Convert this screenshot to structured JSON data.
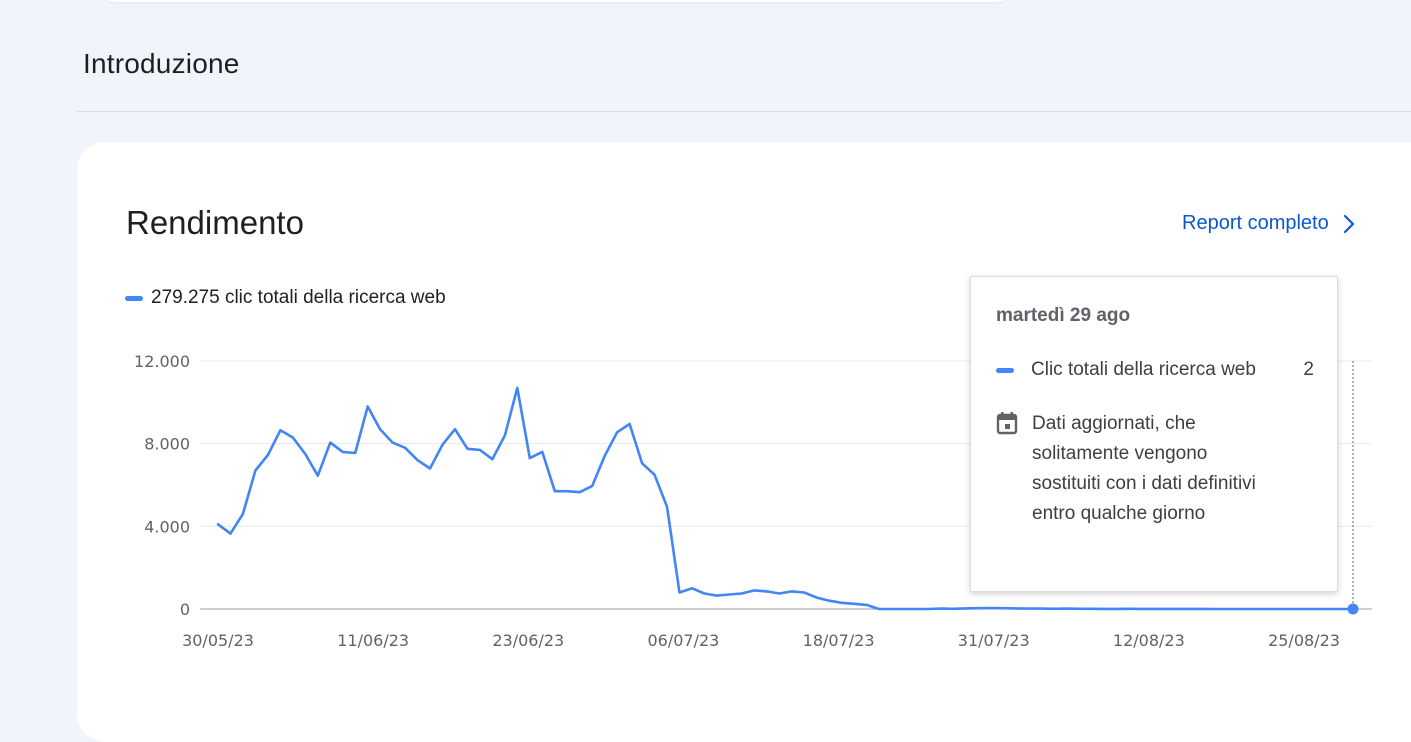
{
  "page": {
    "title": "Introduzione"
  },
  "card": {
    "title": "Rendimento",
    "report_link": "Report completo"
  },
  "legend": {
    "label": "279.275 clic totali della ricerca web",
    "color": "#4285f4"
  },
  "tooltip": {
    "date": "martedì 29 ago",
    "series_label": "Clic totali della ricerca web",
    "series_value": "2",
    "note": "Dati aggiornati, che solitamente vengono sostituiti con i dati definitivi entro qualche giorno",
    "note_icon": "calendar-icon"
  },
  "chart_data": {
    "type": "line",
    "y_tick_labels": [
      "12.000",
      "8.000",
      "4.000",
      "0"
    ],
    "x_tick_labels": [
      "30/05/23",
      "11/06/23",
      "23/06/23",
      "06/07/23",
      "18/07/23",
      "31/07/23",
      "12/08/23",
      "25/08/23"
    ],
    "ylim": [
      0,
      12000
    ],
    "grid": true,
    "legend_position": "top-left",
    "series": [
      {
        "name": "clic totali della ricerca web",
        "color": "#4285f4",
        "x": [
          "2023-05-30",
          "2023-05-31",
          "2023-06-01",
          "2023-06-02",
          "2023-06-03",
          "2023-06-04",
          "2023-06-05",
          "2023-06-06",
          "2023-06-07",
          "2023-06-08",
          "2023-06-09",
          "2023-06-10",
          "2023-06-11",
          "2023-06-12",
          "2023-06-13",
          "2023-06-14",
          "2023-06-15",
          "2023-06-16",
          "2023-06-17",
          "2023-06-18",
          "2023-06-19",
          "2023-06-20",
          "2023-06-21",
          "2023-06-22",
          "2023-06-23",
          "2023-06-24",
          "2023-06-25",
          "2023-06-26",
          "2023-06-27",
          "2023-06-28",
          "2023-06-29",
          "2023-06-30",
          "2023-07-01",
          "2023-07-02",
          "2023-07-03",
          "2023-07-04",
          "2023-07-05",
          "2023-07-06",
          "2023-07-07",
          "2023-07-08",
          "2023-07-09",
          "2023-07-10",
          "2023-07-11",
          "2023-07-12",
          "2023-07-13",
          "2023-07-14",
          "2023-07-15",
          "2023-07-16",
          "2023-07-17",
          "2023-07-18",
          "2023-07-19",
          "2023-07-20",
          "2023-07-21",
          "2023-07-22",
          "2023-07-23",
          "2023-07-24",
          "2023-07-25",
          "2023-07-26",
          "2023-07-27",
          "2023-07-28",
          "2023-07-29",
          "2023-07-30",
          "2023-07-31",
          "2023-08-01",
          "2023-08-02",
          "2023-08-03",
          "2023-08-04",
          "2023-08-05",
          "2023-08-06",
          "2023-08-07",
          "2023-08-08",
          "2023-08-09",
          "2023-08-10",
          "2023-08-11",
          "2023-08-12",
          "2023-08-13",
          "2023-08-14",
          "2023-08-15",
          "2023-08-16",
          "2023-08-17",
          "2023-08-18",
          "2023-08-19",
          "2023-08-20",
          "2023-08-21",
          "2023-08-22",
          "2023-08-23",
          "2023-08-24",
          "2023-08-25",
          "2023-08-26",
          "2023-08-27",
          "2023-08-28",
          "2023-08-29"
        ],
        "values": [
          4100,
          3650,
          4600,
          6700,
          7450,
          8650,
          8300,
          7500,
          6450,
          8050,
          7600,
          7550,
          9800,
          8700,
          8050,
          7800,
          7200,
          6800,
          7950,
          8700,
          7750,
          7700,
          7250,
          8400,
          10700,
          7300,
          7600,
          5700,
          5700,
          5650,
          5950,
          7400,
          8550,
          8950,
          7050,
          6500,
          4950,
          800,
          1000,
          750,
          650,
          700,
          750,
          900,
          850,
          750,
          850,
          800,
          550,
          400,
          300,
          250,
          200,
          0,
          0,
          0,
          0,
          0,
          20,
          10,
          30,
          40,
          50,
          40,
          30,
          20,
          20,
          10,
          20,
          10,
          10,
          5,
          5,
          10,
          5,
          5,
          5,
          5,
          5,
          5,
          2,
          2,
          2,
          2,
          2,
          2,
          2,
          2,
          2,
          2,
          2,
          2
        ]
      }
    ],
    "highlight": {
      "x": "2023-08-29",
      "y": 2
    }
  }
}
